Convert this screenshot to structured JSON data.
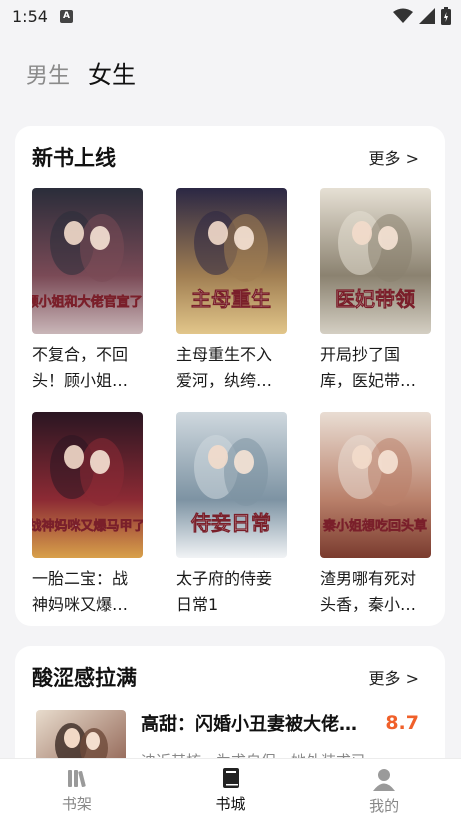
{
  "status": {
    "time": "1:54",
    "notif_letter": "A"
  },
  "gender_tabs": {
    "male": "男生",
    "female": "女生"
  },
  "new_books": {
    "title": "新书上线",
    "more": "更多 >",
    "books": [
      {
        "title": "不复合，不回头！顾小姐和大佬官宣了！",
        "cover_text": "顾小姐和大佬官宣了!",
        "cover_colors": [
          "#2a2d3a",
          "#7a4a56",
          "#c9b6b8"
        ]
      },
      {
        "title": "主母重生不入爱河，纨绔追妻入魔",
        "cover_text": "主母重生",
        "cover_colors": [
          "#2b2744",
          "#a07e52",
          "#e2c68a"
        ]
      },
      {
        "title": "开局抄了国库，医妃带领全家流放",
        "cover_text": "医妃带领",
        "cover_colors": [
          "#e6e0d4",
          "#8b8270",
          "#d4cfc3"
        ]
      },
      {
        "title": "一胎二宝：战神妈咪又爆马甲了",
        "cover_text": "战神妈咪又爆马甲了",
        "cover_colors": [
          "#2a1622",
          "#8c2a34",
          "#d8a04a"
        ]
      },
      {
        "title": "太子府的侍妾日常1",
        "cover_text": "侍妾日常",
        "cover_colors": [
          "#cfd8de",
          "#7d93a3",
          "#f1f3f5"
        ]
      },
      {
        "title": "渣男哪有死对头香，秦小姐想吃回头草",
        "cover_text": "秦小姐想吃回头草",
        "cover_colors": [
          "#e9ddd3",
          "#b9806a",
          "#7a3b2e"
        ]
      }
    ]
  },
  "sour_section": {
    "title": "酸涩感拉满",
    "more": "更多 >",
    "item": {
      "title": "高甜：闪婚小丑妻被大佬…",
      "score": "8.7",
      "desc": "迪近其核，为求自保，她外装求已"
    }
  },
  "bottom_nav": {
    "bookshelf": "书架",
    "bookstore": "书城",
    "mine": "我的"
  }
}
